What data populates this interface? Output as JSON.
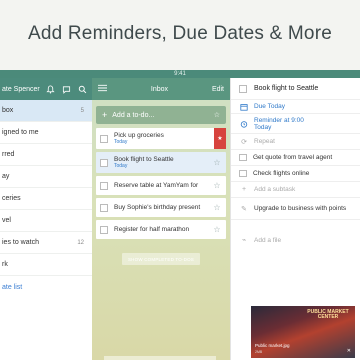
{
  "caption": "Add Reminders, Due Dates & More",
  "statusbar": {
    "time": "9:41"
  },
  "sidebar": {
    "user": "ate Spencer",
    "items": [
      {
        "label": "box",
        "count": "5",
        "active": true
      },
      {
        "label": "igned to me",
        "count": "",
        "active": false
      },
      {
        "label": "rred",
        "count": "",
        "active": false
      },
      {
        "label": "ay",
        "count": "",
        "active": false
      },
      {
        "label": "ceries",
        "count": "",
        "active": false
      },
      {
        "label": "vel",
        "count": "",
        "active": false
      },
      {
        "label": "ies to watch",
        "count": "12",
        "active": false
      },
      {
        "label": "rk",
        "count": "",
        "active": false
      }
    ],
    "create_list": "ate list"
  },
  "inbox": {
    "title": "Inbox",
    "edit": "Edit",
    "add_placeholder": "Add a to-do...",
    "tasks": [
      {
        "text": "Pick up groceries",
        "due": "Today"
      },
      {
        "text": "Book flight to Seattle",
        "due": "Today"
      },
      {
        "text": "Reserve table at YamYam for",
        "due": ""
      },
      {
        "text": "Buy Sophie's birthday present",
        "due": ""
      },
      {
        "text": "Register for half marathon",
        "due": ""
      }
    ],
    "show_completed": "SHOW COMPLETED TO-DOS"
  },
  "detail": {
    "title": "Book flight to Seattle",
    "due": "Due Today",
    "reminder_line1": "Reminder at 9:00",
    "reminder_line2": "Today",
    "repeat": "Repeat",
    "subtasks": [
      "Get quote from travel agent",
      "Check flights online"
    ],
    "add_subtask": "Add a subtask",
    "note": "Upgrade to business with points",
    "add_file": "Add a file",
    "photo_caption": "Public market.jpg",
    "photo_meta": "2MB",
    "photo_sign": "PUBLIC MARKET CENTER"
  },
  "colors": {
    "accent": "#4c8b7c",
    "link": "#2f79c9",
    "flag": "#d7433d"
  }
}
